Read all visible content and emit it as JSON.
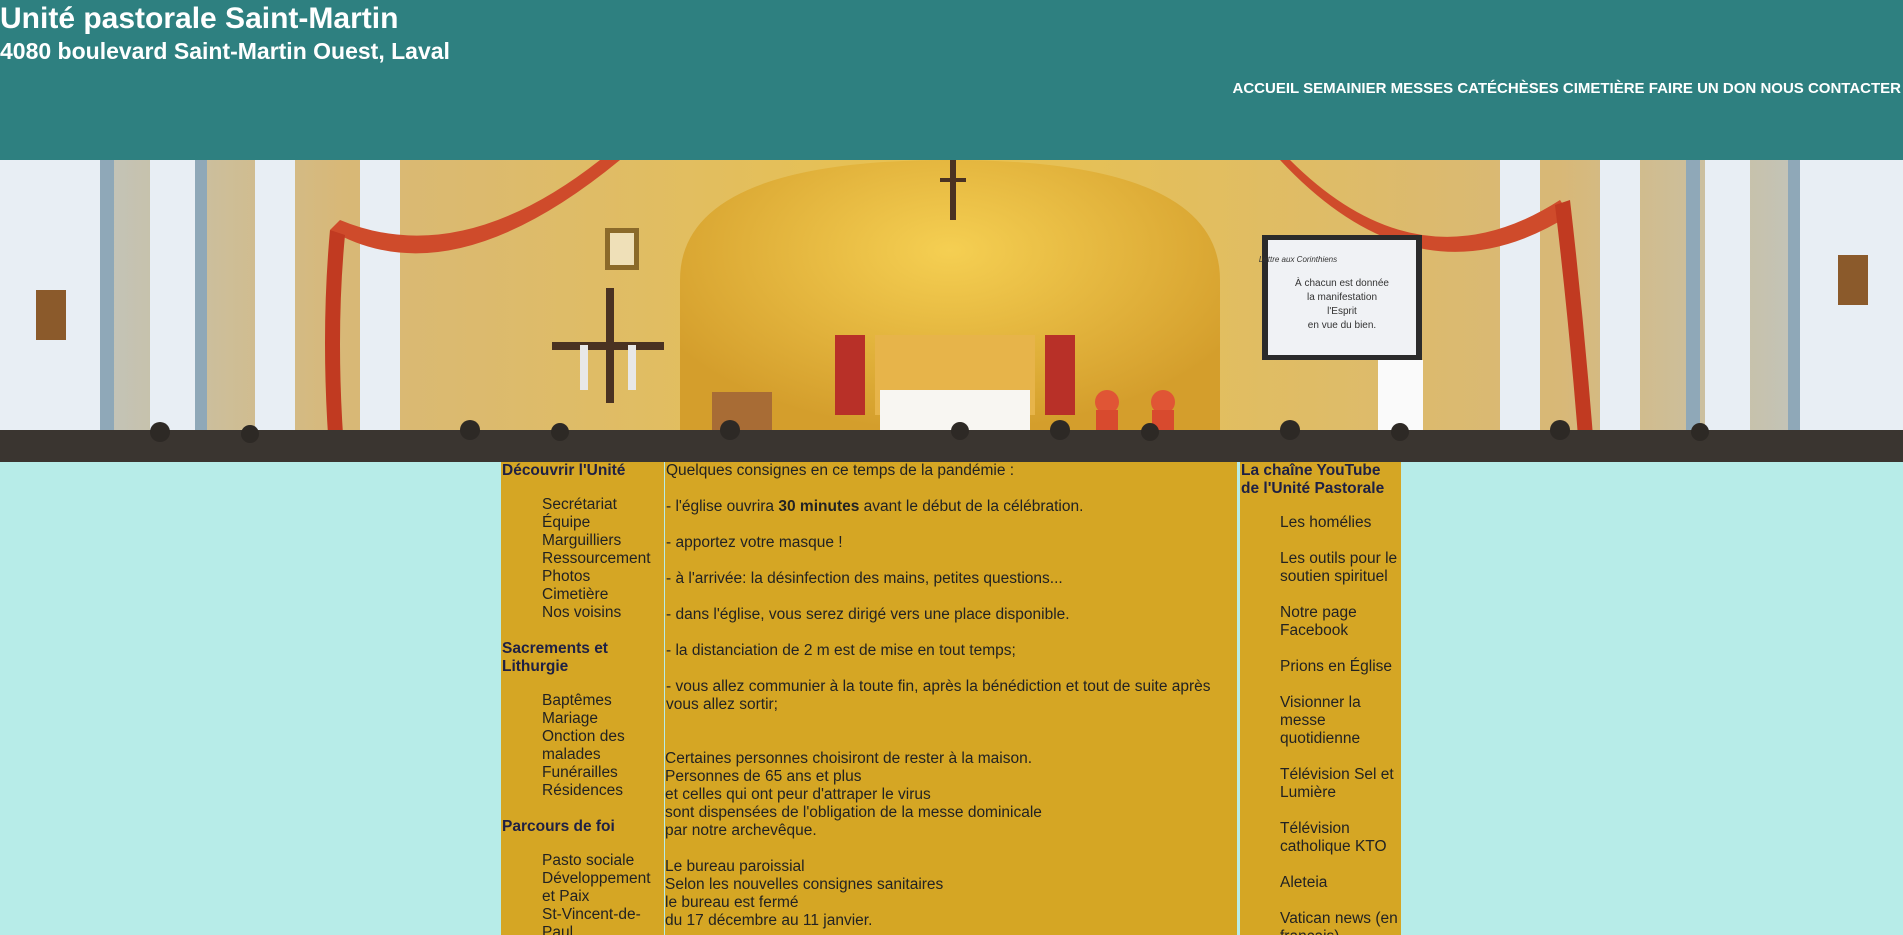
{
  "header": {
    "title": "Unité pastorale Saint-Martin",
    "address": "4080 boulevard Saint-Martin Ouest, Laval"
  },
  "nav": [
    "ACCUEIL",
    "SEMAINIER",
    "MESSES",
    "CATÉCHÈSES",
    "CIMETIÈRE",
    "FAIRE UN DON",
    "NOUS CONTACTER"
  ],
  "banner": {
    "screen_lines": [
      "Lettre aux Corinthiens",
      "À chacun est donnée",
      "la manifestation",
      "l'Esprit",
      "en vue du bien."
    ]
  },
  "left": {
    "sections": [
      {
        "title": "Découvrir l'Unité",
        "items": [
          "Secrétariat",
          "Équipe",
          "Marguilliers",
          "Ressourcement",
          "Photos",
          "Cimetière",
          "Nos voisins"
        ]
      },
      {
        "title": "Sacrements et Lithurgie",
        "items": [
          "Baptêmes",
          "Mariage",
          "Onction des malades",
          "Funérailles",
          "Résidences"
        ]
      },
      {
        "title": "Parcours de foi",
        "items": [
          "Pasto sociale",
          "Développement et Paix",
          "St-Vincent-de-Paul"
        ]
      }
    ]
  },
  "center": {
    "intro": "Quelques consignes en ce temps de la pandémie :",
    "item1_pre": "- l'église ouvrira ",
    "item1_bold": "30 minutes",
    "item1_post": " avant le début de la célébration.",
    "item2": "- apportez votre masque !",
    "item3": "- à l'arrivée: la désinfection des mains, petites questions...",
    "item4": "- dans l'église, vous serez dirigé vers une place disponible.",
    "item5": "- la distanciation de 2 m est de mise en tout temps;",
    "item6": "- vous allez communier à la toute fin, après la bénédiction et tout de suite après vous allez sortir;",
    "para2": [
      "Certaines personnes choisiront de rester à la maison.",
      "Personnes de 65 ans et plus",
      "et celles qui ont peur d'attraper le virus",
      "sont dispensées de l'obligation de la messe dominicale",
      "par notre archevêque."
    ],
    "para3": [
      "Le bureau paroissial",
      "Selon les nouvelles consignes sanitaires",
      "le bureau est fermé",
      "du 17 décembre au 11 janvier."
    ]
  },
  "right": {
    "title": "La chaîne YouTube de l'Unité Pastorale",
    "items": [
      "Les homélies",
      "Les outils pour le soutien spirituel",
      "Notre page Facebook",
      "Prions en Église",
      "Visionner la messe quotidienne",
      "Télévision Sel et Lumière",
      "Télévision catholique KTO",
      "Aleteia",
      "Vatican news (en français)"
    ]
  },
  "colors": {
    "header_bg": "#2e8080",
    "page_bg": "#b7ece8",
    "column_bg": "#d5a624",
    "section_title": "#1e2044"
  }
}
